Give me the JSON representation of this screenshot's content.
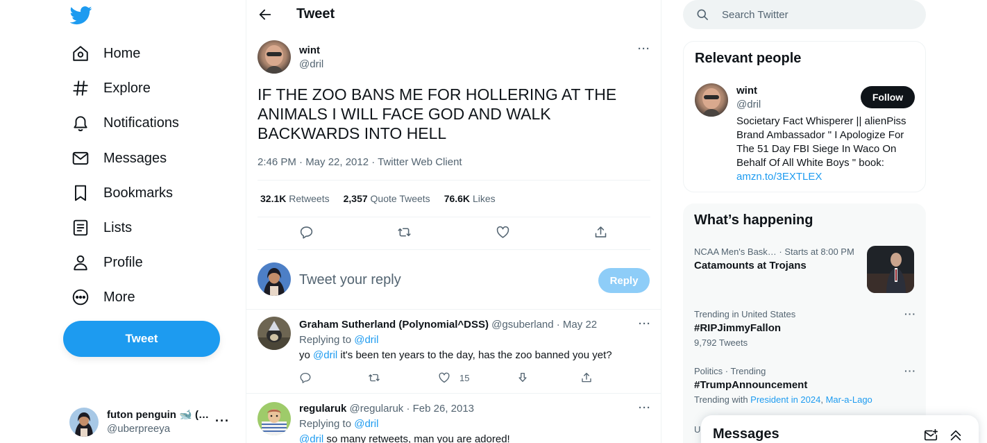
{
  "nav": {
    "items": [
      {
        "label": "Home",
        "icon": "home-icon"
      },
      {
        "label": "Explore",
        "icon": "hashtag-icon"
      },
      {
        "label": "Notifications",
        "icon": "bell-icon"
      },
      {
        "label": "Messages",
        "icon": "envelope-icon"
      },
      {
        "label": "Bookmarks",
        "icon": "bookmark-icon"
      },
      {
        "label": "Lists",
        "icon": "list-icon"
      },
      {
        "label": "Profile",
        "icon": "person-icon"
      },
      {
        "label": "More",
        "icon": "more-circle-icon"
      }
    ],
    "tweet_button": "Tweet"
  },
  "account": {
    "display_name": "futon penguin 🐋 (…",
    "handle": "@uberpreeya"
  },
  "header": {
    "title": "Tweet"
  },
  "focal_tweet": {
    "name": "wint",
    "handle": "@dril",
    "text": "IF THE ZOO BANS ME FOR HOLLERING AT THE ANIMALS I WILL FACE GOD AND WALK BACKWARDS INTO HELL",
    "meta": "2:46 PM · May 22, 2012 · Twitter Web Client",
    "stats": [
      {
        "value": "32.1K",
        "label": "Retweets"
      },
      {
        "value": "2,357",
        "label": "Quote Tweets"
      },
      {
        "value": "76.6K",
        "label": "Likes"
      }
    ]
  },
  "reply_box": {
    "placeholder": "Tweet your reply",
    "button": "Reply"
  },
  "replies": [
    {
      "name": "Graham Sutherland (Polynomial^DSS)",
      "handle_time": "@gsuberland · May 22",
      "replying_label": "Replying to",
      "replying_to": "@dril",
      "mention": "@dril",
      "text": " it's been ten years to the day, has the zoo banned you yet?",
      "like_count": "15"
    },
    {
      "name": "regularuk",
      "handle_time": "@regularuk · Feb 26, 2013",
      "replying_label": "Replying to",
      "replying_to": "@dril",
      "mention": "@dril",
      "text": " so many retweets, man you are adored!"
    }
  ],
  "search": {
    "placeholder": "Search Twitter"
  },
  "relevant": {
    "title": "Relevant people",
    "name": "wint",
    "handle": "@dril",
    "follow": "Follow",
    "bio": "Societary Fact Whisperer || alienPiss Brand Ambassador \" I Apologize For The 51 Day FBI Siege In Waco On Behalf Of All White Boys \" book: ",
    "bio_link": "amzn.to/3EXTLEX"
  },
  "happening": {
    "title": "What’s happening",
    "trends": [
      {
        "context": "NCAA Men's Bask… · Starts at 8:00 PM",
        "title": "Catamounts at Trojans"
      },
      {
        "context": "Trending in United States",
        "title": "#RIPJimmyFallon",
        "sub": "9,792 Tweets"
      },
      {
        "context": "Politics · Trending",
        "title": "#TrumpAnnouncement",
        "sub_prefix": "Trending with ",
        "sub_link1": "President in 2024",
        "sub_sep": ", ",
        "sub_link2": "Mar-a-Lago"
      },
      {
        "context": "U"
      }
    ]
  },
  "messages_drawer": {
    "title": "Messages"
  },
  "colors": {
    "accent": "#1d9bf0",
    "text": "#0f1419",
    "muted": "#536471",
    "follow_bg": "#0f1419"
  }
}
